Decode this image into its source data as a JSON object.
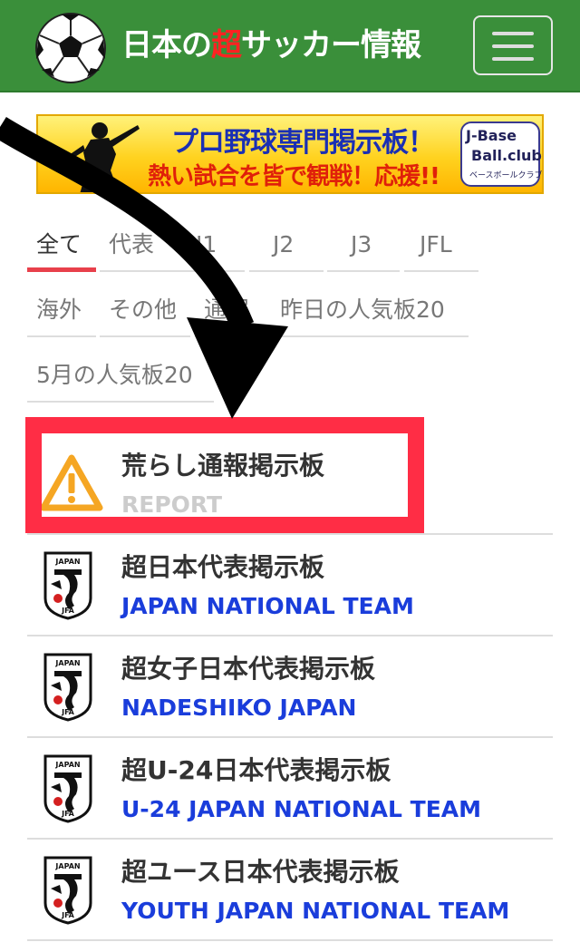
{
  "header": {
    "title_prefix": "日本の",
    "title_accent": "超",
    "title_suffix": "サッカー情報",
    "accent_color": "#ff2222",
    "background_color": "#3a8f3a"
  },
  "banner": {
    "line1": "プロ野球専門掲示板！",
    "line2": "熱い試合を皆で観戦！応援!!",
    "logo_line1": "J-Base",
    "logo_line2": "Ball.club",
    "logo_line3": "ベースボールクラブ"
  },
  "tabs": [
    {
      "label": "全て",
      "active": true
    },
    {
      "label": "代表"
    },
    {
      "label": "J1"
    },
    {
      "label": "J2"
    },
    {
      "label": "J3"
    },
    {
      "label": "JFL"
    },
    {
      "label": "海外"
    },
    {
      "label": "その他"
    },
    {
      "label": "通報"
    },
    {
      "label": "昨日の人気板20"
    },
    {
      "label": "5月の人気板20"
    }
  ],
  "boards": [
    {
      "title": "荒らし通報掲示板",
      "subtitle": "REPORT",
      "icon": "warning-icon"
    },
    {
      "title": "超日本代表掲示板",
      "subtitle": "JAPAN NATIONAL TEAM",
      "icon": "jfa-emblem-icon"
    },
    {
      "title": "超女子日本代表掲示板",
      "subtitle": "NADESHIKO JAPAN",
      "icon": "jfa-emblem-icon"
    },
    {
      "title": "超U-24日本代表掲示板",
      "subtitle": "U-24 JAPAN NATIONAL TEAM",
      "icon": "jfa-emblem-icon"
    },
    {
      "title": "超ユース日本代表掲示板",
      "subtitle": "YOUTH JAPAN NATIONAL TEAM",
      "icon": "jfa-emblem-icon"
    }
  ],
  "emblem_text": "JAPAN",
  "emblem_letters": "JFA",
  "colors": {
    "tab_active_underline": "#e8404b",
    "subtitle_blue": "#1a3ddb",
    "highlight_red": "#ff2d45",
    "warning_orange": "#f5a623"
  }
}
